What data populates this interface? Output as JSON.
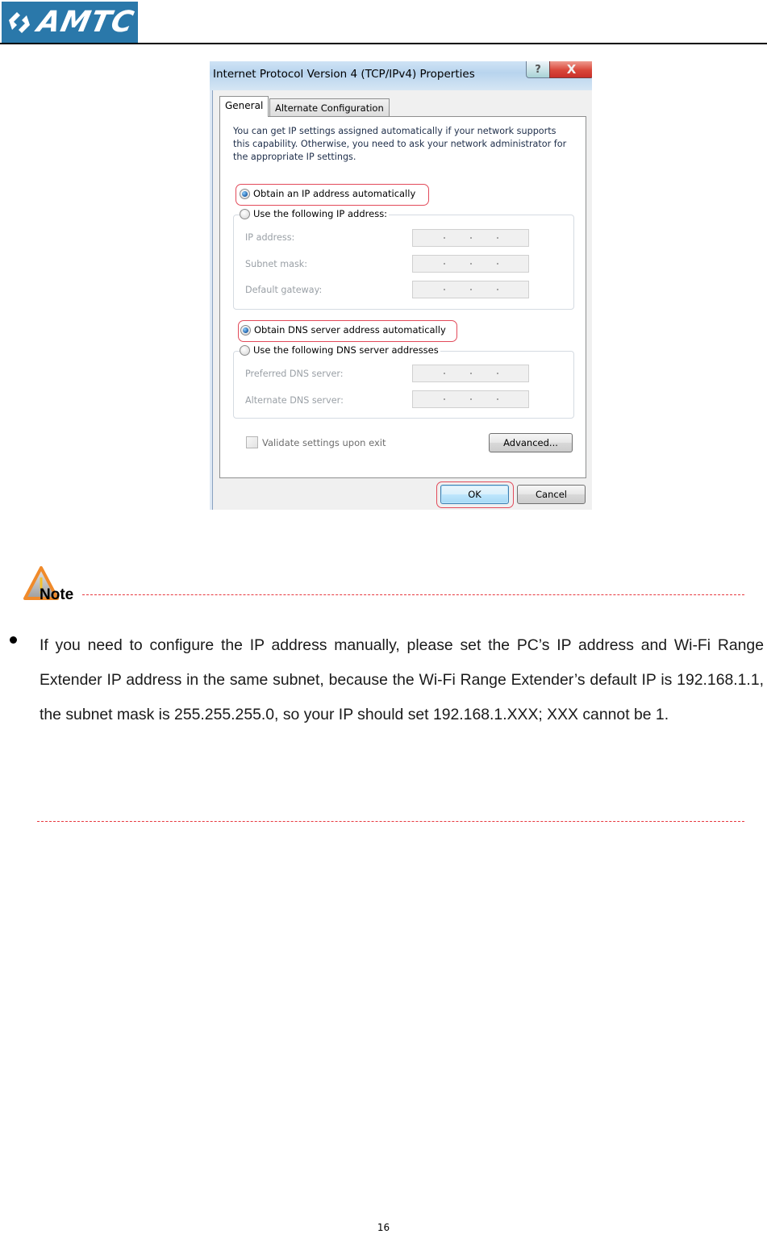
{
  "header": {
    "logo_text": "AMTC",
    "brand_color": "#2a78aa"
  },
  "dialog": {
    "title": "Internet Protocol Version 4 (TCP/IPv4) Properties",
    "help_button_glyph": "?",
    "close_button_glyph": "X",
    "tabs": [
      {
        "label": "General",
        "active": true
      },
      {
        "label": "Alternate Configuration",
        "active": false
      }
    ],
    "intro_text": "You can get IP settings assigned automatically if your network supports this capability. Otherwise, you need to ask your network administrator for the appropriate IP settings.",
    "ip_section": {
      "auto_option": "Obtain an IP address automatically",
      "manual_option": "Use the following IP address:",
      "selected": "auto",
      "fields": [
        {
          "label": "IP address:",
          "value": ". . ."
        },
        {
          "label": "Subnet mask:",
          "value": ". . ."
        },
        {
          "label": "Default gateway:",
          "value": ". . ."
        }
      ]
    },
    "dns_section": {
      "auto_option": "Obtain DNS server address automatically",
      "manual_option": "Use the following DNS server addresses",
      "selected": "auto",
      "fields": [
        {
          "label": "Preferred DNS server:",
          "value": ". . ."
        },
        {
          "label": "Alternate DNS server:",
          "value": ". . ."
        }
      ]
    },
    "validate_checkbox": {
      "label": "Validate settings upon exit",
      "checked": false
    },
    "advanced_button": "Advanced...",
    "ok_button": "OK",
    "cancel_button": "Cancel",
    "highlight_color": "#e24a5a"
  },
  "note": {
    "label": "Note",
    "icon": "warning-triangle-icon",
    "divider_color": "#e8383f",
    "bullets": [
      "If you need to configure the IP address manually, please set the PC’s IP address and Wi-Fi Range Extender IP address in the same subnet, because the Wi-Fi Range Extender’s default IP is 192.168.1.1, the subnet mask is 255.255.255.0, so your IP should set 192.168.1.XXX; XXX cannot be 1."
    ]
  },
  "footer": {
    "page_number": "16"
  }
}
